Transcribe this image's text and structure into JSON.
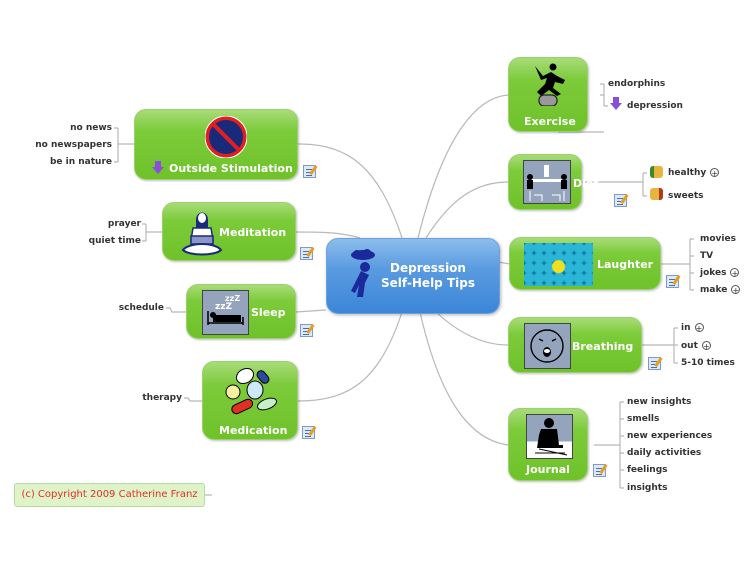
{
  "center": {
    "title_line1": "Depression",
    "title_line2": "Self-Help Tips",
    "icon": "sad-person-cloud-icon"
  },
  "colors": {
    "node_green": "#6fc22a",
    "center_blue": "#3c86d8",
    "connector": "#b3b3b3",
    "copyright_text": "#e0302a",
    "copyright_bg": "#dff3c8"
  },
  "right_topics": [
    {
      "label": "Exercise",
      "icon": "jumping-person-icon",
      "leaves": [
        "endorphins",
        "depression"
      ],
      "leaf_icons": [
        "",
        "down-arrow-icon"
      ]
    },
    {
      "label": "Diet",
      "icon": "dining-table-icon",
      "leaves": [
        "healthy",
        "sweets"
      ],
      "leaf_icons": [
        "thumbs-up-icon",
        "thumbs-down-icon"
      ],
      "expandable": [
        true,
        false
      ]
    },
    {
      "label": "Laughter",
      "icon": "smiley-crowd-icon",
      "leaves": [
        "movies",
        "TV",
        "jokes",
        "make"
      ],
      "expandable": [
        false,
        false,
        true,
        true
      ]
    },
    {
      "label": "Breathing",
      "icon": "breathing-face-icon",
      "leaves": [
        "in",
        "out",
        "5-10 times"
      ],
      "expandable": [
        true,
        true,
        false
      ]
    },
    {
      "label": "Journal",
      "icon": "writing-person-icon",
      "leaves": [
        "new insights",
        "smells",
        "new experiences",
        "daily activities",
        "feelings",
        "insights"
      ]
    }
  ],
  "left_topics": [
    {
      "label": "Outside Stimulation",
      "icon": "no-entry-sign-icon",
      "label_icon": "down-arrow-icon",
      "leaves": [
        "no news",
        "no newspapers",
        "be in nature"
      ]
    },
    {
      "label": "Meditation",
      "icon": "meditating-woman-icon",
      "leaves": [
        "prayer",
        "quiet time"
      ]
    },
    {
      "label": "Sleep",
      "icon": "bed-zzz-icon",
      "leaves": [
        "schedule"
      ]
    },
    {
      "label": "Medication",
      "icon": "pills-icon",
      "leaves": [
        "therapy"
      ]
    }
  ],
  "expand_symbol": "+",
  "copyright": "(c) Copyright 2009 Catherine Franz"
}
